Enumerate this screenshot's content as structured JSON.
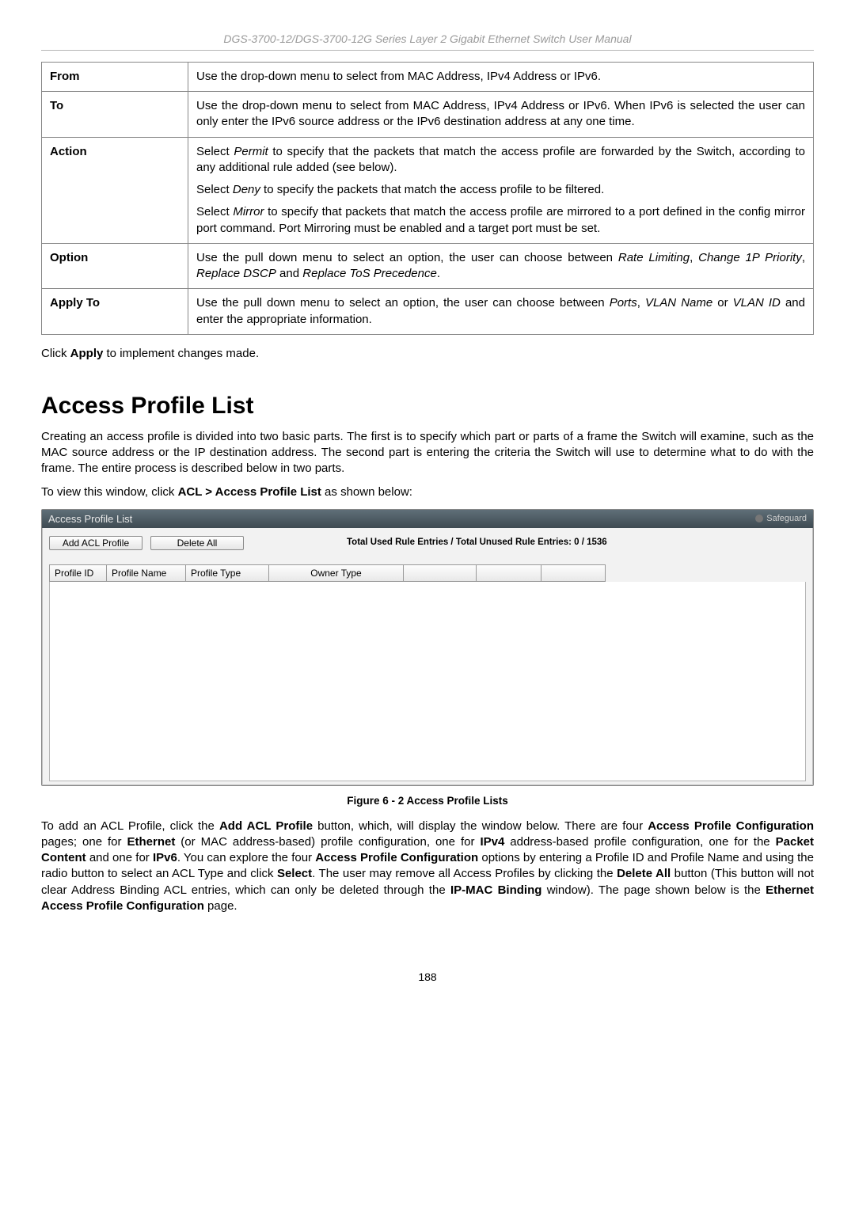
{
  "header": {
    "title": "DGS-3700-12/DGS-3700-12G Series Layer 2 Gigabit Ethernet Switch User Manual"
  },
  "param_table": {
    "rows": [
      {
        "label": "From",
        "paras": [
          "Use the drop-down menu to select from MAC Address, IPv4 Address or IPv6."
        ]
      },
      {
        "label": "To",
        "paras": [
          "Use the drop-down menu to select from MAC Address, IPv4 Address or IPv6. When IPv6 is selected the user can only enter the IPv6 source address or the IPv6 destination address at any one time."
        ]
      },
      {
        "label": "Action",
        "paras": [
          "Select <span class=\"ital\">Permit</span> to specify that the packets that match the access profile are forwarded by the Switch, according to any additional rule added (see below).",
          "Select <span class=\"ital\">Deny</span> to specify the packets that match the access profile to be filtered.",
          "Select <span class=\"ital\">Mirror</span> to specify that packets that match the access profile are mirrored to a port defined in the config mirror port command. Port Mirroring must be enabled and a target port must be set."
        ]
      },
      {
        "label": "Option",
        "paras": [
          "Use the pull down menu to select an option, the user can choose between <span class=\"ital\">Rate Limiting</span>, <span class=\"ital\">Change 1P Priority</span>, <span class=\"ital\">Replace DSCP</span> and <span class=\"ital\">Replace ToS Precedence</span>."
        ]
      },
      {
        "label": "Apply To",
        "paras": [
          "Use the pull down menu to select an option, the user can choose between <span class=\"ital\">Ports</span>, <span class=\"ital\">VLAN Name</span> or <span class=\"ital\">VLAN ID</span> and enter the appropriate information."
        ]
      }
    ]
  },
  "after_table_line": "Click <span class=\"bold\">Apply</span> to implement changes made.",
  "section": {
    "title": "Access Profile List",
    "intro": "Creating an access profile is divided into two basic parts. The first is to specify which part or parts of a frame the Switch will examine, such as the MAC source address or the IP destination address. The second part is entering the criteria the Switch will use to determine what to do with the frame. The entire process is described below in two parts.",
    "nav_line": "To view this window, click <span class=\"bold\">ACL &gt; Access Profile List</span> as shown below:"
  },
  "panel": {
    "title": "Access Profile List",
    "safeguard": "Safeguard",
    "add_btn": "Add ACL Profile",
    "delete_btn": "Delete All",
    "rule_entries_label": "Total Used Rule Entries / Total Unused Rule Entries: 0 / 1536",
    "columns": {
      "id": "Profile ID",
      "name": "Profile Name",
      "type": "Profile Type",
      "owner": "Owner Type"
    }
  },
  "figure_caption": "Figure 6 - 2 Access Profile Lists",
  "body_para": "To add an ACL Profile, click the <span class=\"bold\">Add ACL Profile</span> button, which, will display the window below. There are four <span class=\"bold\">Access Profile Configuration</span> pages; one for <span class=\"bold\">Ethernet</span> (or MAC address-based) profile configuration, one for <span class=\"bold\">IPv4</span> address-based profile configuration, one for the <span class=\"bold\">Packet Content</span> and one for <span class=\"bold\">IPv6</span>. You can explore the four <span class=\"bold\">Access Profile Configuration</span> options by entering a Profile ID and Profile Name and using the radio button to select an ACL Type and click <span class=\"bold\">Select</span>. The user may remove all Access Profiles by clicking the <span class=\"bold\">Delete All</span> button (This button will not clear Address Binding ACL entries, which can only be deleted through the <span class=\"bold\">IP-MAC Binding</span> window). The page shown below is the <span class=\"bold\">Ethernet Access Profile Configuration</span> page.",
  "page_number": "188"
}
